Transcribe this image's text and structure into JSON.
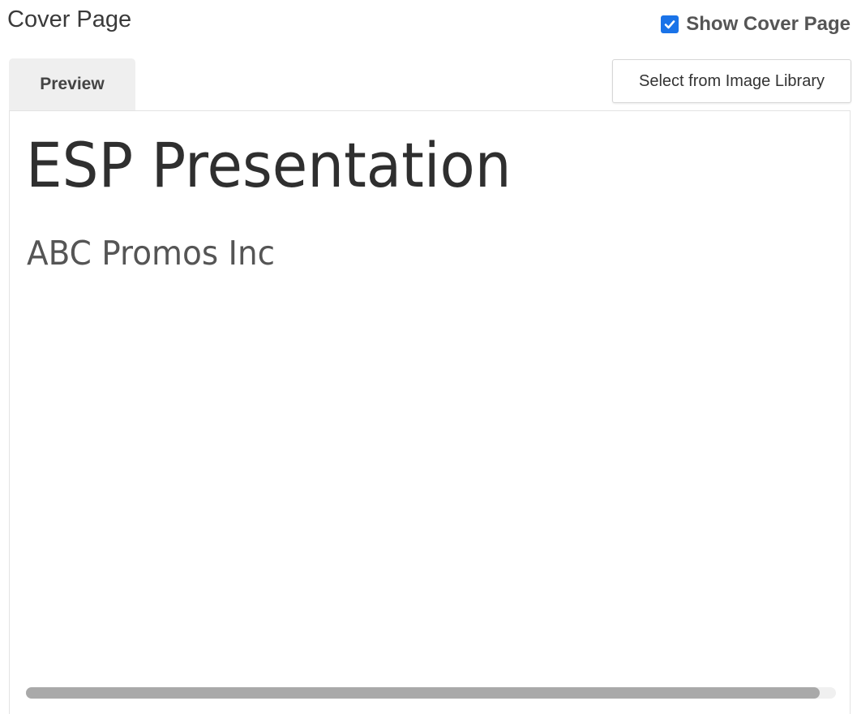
{
  "header": {
    "title": "Cover Page",
    "show_cover_label": "Show Cover Page",
    "show_cover_checked": true
  },
  "tabs": [
    {
      "label": "Preview",
      "active": true
    }
  ],
  "toolbar": {
    "library_button_label": "Select from Image Library"
  },
  "preview": {
    "title": "ESP Presentation",
    "subtitle": "ABC Promos Inc"
  },
  "scrollbar": {
    "visible_fraction": 0.98
  },
  "colors": {
    "accent": "#1a73e8",
    "tab_background": "#efefef",
    "scroll_thumb": "#a9a9a9"
  }
}
